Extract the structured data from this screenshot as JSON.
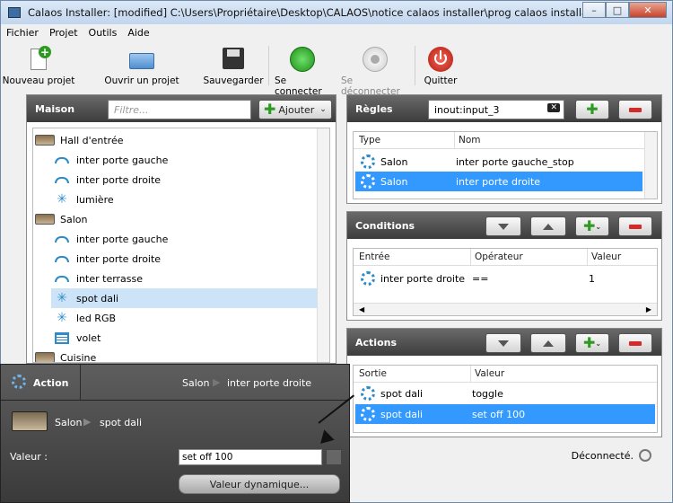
{
  "window": {
    "title": "Calaos Installer: [modified] C:\\Users\\Propriétaire\\Desktop\\CALAOS\\notice calaos installer\\prog calaos installater"
  },
  "menu": [
    "Fichier",
    "Projet",
    "Outils",
    "Aide"
  ],
  "toolbar": {
    "new_project": "Nouveau projet",
    "open_project": "Ouvrir un projet",
    "save": "Sauvegarder",
    "connect": "Se connecter",
    "disconnect": "Se déconnecter",
    "quit": "Quitter"
  },
  "maison": {
    "title": "Maison",
    "filter_placeholder": "Filtre...",
    "add_label": "Ajouter",
    "tree": [
      {
        "type": "room",
        "label": "Hall d'entrée"
      },
      {
        "type": "inter",
        "label": "inter porte gauche"
      },
      {
        "type": "inter",
        "label": "inter porte droite"
      },
      {
        "type": "light",
        "label": "lumière"
      },
      {
        "type": "room",
        "label": "Salon"
      },
      {
        "type": "inter",
        "label": "inter porte gauche"
      },
      {
        "type": "inter",
        "label": "inter porte droite"
      },
      {
        "type": "inter",
        "label": "inter terrasse"
      },
      {
        "type": "light",
        "label": "spot dali",
        "selected": true
      },
      {
        "type": "light",
        "label": "led RGB"
      },
      {
        "type": "volet",
        "label": "volet"
      },
      {
        "type": "room",
        "label": "Cuisine"
      }
    ]
  },
  "regles": {
    "title": "Règles",
    "search_value": "inout:input_3",
    "columns": [
      "Type",
      "Nom"
    ],
    "rows": [
      {
        "type": "Salon",
        "nom": "inter porte gauche_stop"
      },
      {
        "type": "Salon",
        "nom": "inter porte droite",
        "selected": true
      }
    ]
  },
  "conditions": {
    "title": "Conditions",
    "columns": [
      "Entrée",
      "Opérateur",
      "Valeur"
    ],
    "rows": [
      {
        "entree": "inter porte droite",
        "operateur": "==",
        "valeur": "1"
      }
    ]
  },
  "actions": {
    "title": "Actions",
    "columns": [
      "Sortie",
      "Valeur"
    ],
    "rows": [
      {
        "sortie": "spot dali",
        "valeur": "toggle"
      },
      {
        "sortie": "spot dali",
        "valeur": "set off 100",
        "selected": true
      }
    ]
  },
  "popup": {
    "title": "Action",
    "crumb_room": "Salon",
    "crumb_item": "inter porte droite",
    "device_room": "Salon",
    "device_item": "spot dali",
    "value_label": "Valeur :",
    "value": "set off 100",
    "dynamic_button": "Valeur dynamique..."
  },
  "status": {
    "text": "Déconnecté."
  },
  "colors": {
    "accent": "#3399ff",
    "header_dark": "#3c3c3c",
    "add_green": "#2e9a22",
    "remove_red": "#d42a2a",
    "icon_blue": "#2e8bc8"
  }
}
